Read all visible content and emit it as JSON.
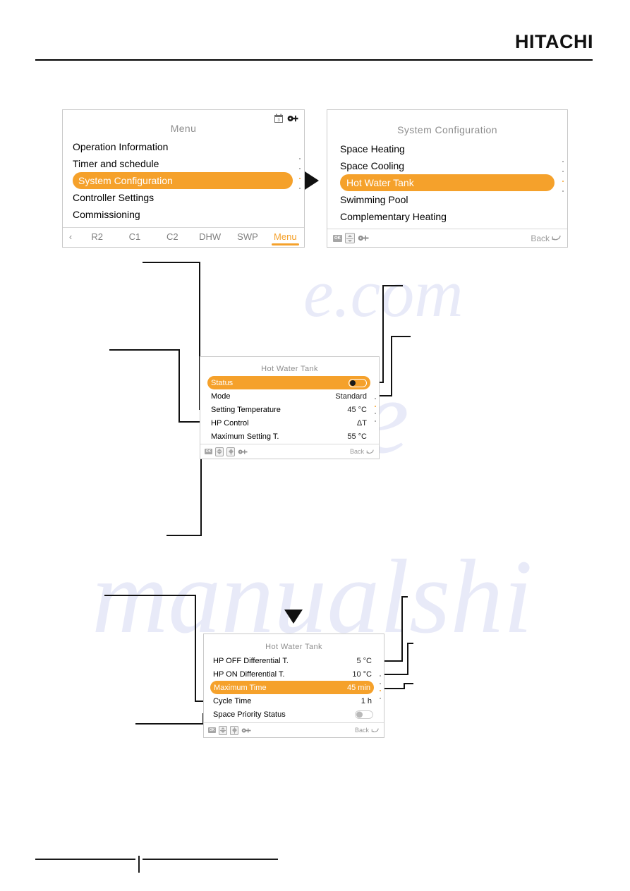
{
  "brand": "HITACHI",
  "watermark": "manualshive.com",
  "panels": {
    "menu": {
      "title": "Menu",
      "header_icons": [
        "calendar-icon",
        "wrench-icon"
      ],
      "items": [
        {
          "label": "Operation Information",
          "selected": false
        },
        {
          "label": "Timer and schedule",
          "selected": false
        },
        {
          "label": "System Configuration",
          "selected": true
        },
        {
          "label": "Controller Settings",
          "selected": false
        },
        {
          "label": "Commissioning",
          "selected": false
        }
      ],
      "tabs": [
        {
          "label": "R2",
          "active": false
        },
        {
          "label": "C1",
          "active": false
        },
        {
          "label": "C2",
          "active": false
        },
        {
          "label": "DHW",
          "active": false
        },
        {
          "label": "SWP",
          "active": false
        },
        {
          "label": "Menu",
          "active": true
        }
      ],
      "back_arrow": "‹"
    },
    "system_configuration": {
      "title": "System Configuration",
      "items": [
        {
          "label": "Space Heating",
          "selected": false
        },
        {
          "label": "Space Cooling",
          "selected": false
        },
        {
          "label": "Hot Water Tank",
          "selected": true
        },
        {
          "label": "Swimming Pool",
          "selected": false
        },
        {
          "label": "Complementary Heating",
          "selected": false
        }
      ],
      "bar_icons": [
        "ok-icon",
        "updown-icon",
        "wrench-icon"
      ],
      "back_label": "Back"
    },
    "hot_water_tank_1": {
      "title": "Hot Water Tank",
      "rows": [
        {
          "label": "Status",
          "value": "",
          "control": "toggle-on",
          "selected": true
        },
        {
          "label": "Mode",
          "value": "Standard",
          "control": "",
          "selected": false
        },
        {
          "label": "Setting Temperature",
          "value": "45 °C",
          "control": "",
          "selected": false
        },
        {
          "label": "HP Control",
          "value": "ΔT",
          "control": "",
          "selected": false
        },
        {
          "label": "Maximum Setting T.",
          "value": "55 °C",
          "control": "",
          "selected": false
        }
      ],
      "bar_icons": [
        "ok-icon",
        "updown-icon",
        "leftright-icon",
        "wrench-icon"
      ],
      "back_label": "Back"
    },
    "hot_water_tank_2": {
      "title": "Hot Water Tank",
      "rows": [
        {
          "label": "HP OFF Differential T.",
          "value": "5 °C",
          "control": "",
          "selected": false
        },
        {
          "label": "HP ON Differential T.",
          "value": "10 °C",
          "control": "",
          "selected": false
        },
        {
          "label": "Maximum Time",
          "value": "45 min",
          "control": "",
          "selected": true
        },
        {
          "label": "Cycle Time",
          "value": "1 h",
          "control": "",
          "selected": false
        },
        {
          "label": "Space Priority Status",
          "value": "",
          "control": "toggle-off",
          "selected": false
        }
      ],
      "bar_icons": [
        "ok-icon",
        "updown-icon",
        "leftright-icon",
        "wrench-icon"
      ],
      "back_label": "Back"
    }
  },
  "colors": {
    "accent": "#F5A12B",
    "panel_border": "#c9c9c9",
    "title_grey": "#8d8d8d",
    "line_black": "#111111"
  }
}
